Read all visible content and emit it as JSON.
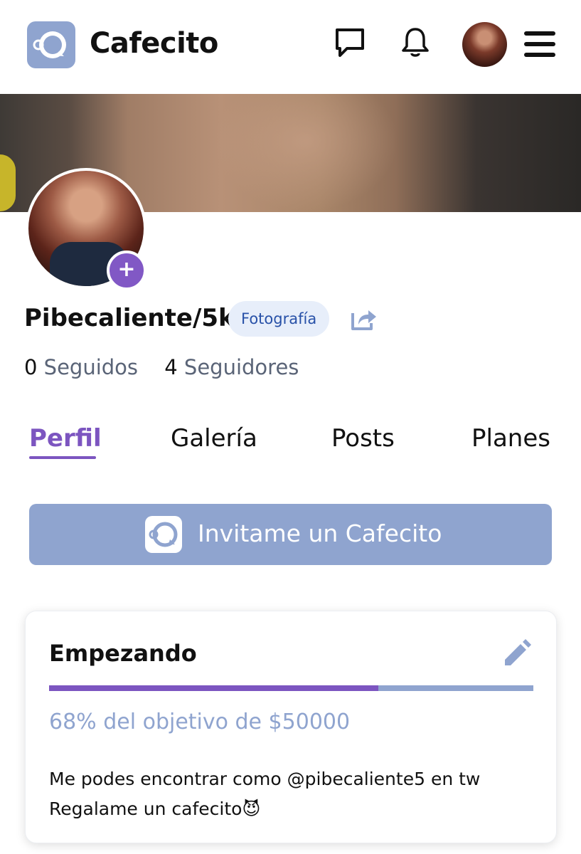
{
  "header": {
    "brand": "Cafecito",
    "icons": [
      "chat-icon",
      "bell-icon",
      "menu-icon"
    ]
  },
  "profile": {
    "username": "Pibecaliente/5k",
    "category": "Fotografía",
    "following_count": "0",
    "following_label": "Seguidos",
    "followers_count": "4",
    "followers_label": "Seguidores",
    "add_badge": "+"
  },
  "tabs": [
    {
      "label": "Perfil",
      "active": true
    },
    {
      "label": "Galería",
      "active": false
    },
    {
      "label": "Posts",
      "active": false
    },
    {
      "label": "Planes",
      "active": false
    }
  ],
  "invite_button": {
    "label": "Invitame un Cafecito"
  },
  "goal": {
    "title": "Empezando",
    "progress_fraction": 0.68,
    "summary": "68% del objetivo de $50000",
    "description_line1": "Me podes encontrar como @pibecaliente5 en tw",
    "description_line2": "Regalame un cafecito😈"
  },
  "colors": {
    "accent_purple": "#7c55c0",
    "brand_blue": "#8fa4cf",
    "tag_bg": "#e7eefa",
    "tag_text": "#2851a8"
  }
}
